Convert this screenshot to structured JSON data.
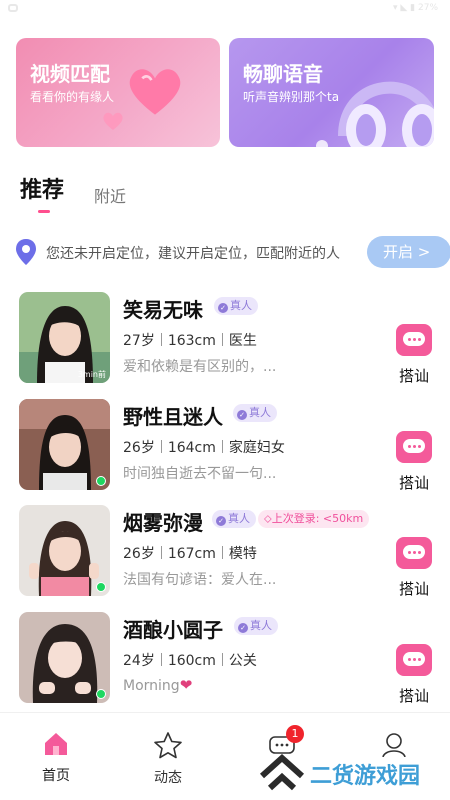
{
  "status_bar": {
    "right_text": "▾ ◣ ▮ 27%"
  },
  "banners": [
    {
      "title": "视频匹配",
      "subtitle": "看看你的有缘人"
    },
    {
      "title": "畅聊语音",
      "subtitle": "听声音辨别那个ta"
    }
  ],
  "tabs": {
    "active": "推荐",
    "inactive": "附近"
  },
  "location": {
    "text": "您还未开启定位，建议开启定位，匹配附近的人",
    "button": "开启 >"
  },
  "users": [
    {
      "name": "笑易无味",
      "badge": "真人",
      "age": "27岁",
      "height": "163cm",
      "job": "医生",
      "bio": "爱和依赖是有区别的，...",
      "status": "3min前",
      "online": false,
      "action": "搭讪"
    },
    {
      "name": "野性且迷人",
      "badge": "真人",
      "age": "26岁",
      "height": "164cm",
      "job": "家庭妇女",
      "bio": "时间独自逝去不留一句...",
      "status": "",
      "online": true,
      "action": "搭讪"
    },
    {
      "name": "烟雾弥漫",
      "badge": "真人",
      "login": "上次登录: <50km",
      "age": "26岁",
      "height": "167cm",
      "job": "模特",
      "bio": "法国有句谚语：爱人在...",
      "status": "",
      "online": true,
      "action": "搭讪"
    },
    {
      "name": "酒酿小圆子",
      "badge": "真人",
      "age": "24岁",
      "height": "160cm",
      "job": "公关",
      "bio": "Morning",
      "bio_emoji": "❤",
      "status": "",
      "online": true,
      "action": "搭讪"
    }
  ],
  "nav": {
    "items": [
      {
        "label": "首页",
        "icon": "home-icon",
        "active": true
      },
      {
        "label": "动态",
        "icon": "star-icon"
      },
      {
        "label": "",
        "icon": "message-icon",
        "badge": "1"
      },
      {
        "label": "",
        "icon": "profile-icon"
      }
    ]
  },
  "watermark": {
    "text": "二货游戏园"
  },
  "colors": {
    "accent": "#ff4f8e",
    "real_badge": "#8e7ad8",
    "online": "#1ed760",
    "open_button": "#a9c9f4"
  }
}
